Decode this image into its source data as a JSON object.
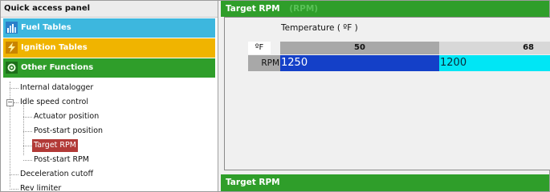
{
  "quick_access": {
    "title": "Quick access panel",
    "categories": [
      {
        "label": "Fuel Tables",
        "icon": "fuel-table-icon",
        "color": "#3db7de"
      },
      {
        "label": "Ignition Tables",
        "icon": "ignition-icon",
        "color": "#f0b400"
      },
      {
        "label": "Other Functions",
        "icon": "other-functions-icon",
        "color": "#2f9e2a"
      }
    ],
    "tree": [
      {
        "label": "Internal datalogger"
      },
      {
        "label": "Idle speed control",
        "expanded": true
      },
      {
        "label": "Actuator position"
      },
      {
        "label": "Post-start position"
      },
      {
        "label": "Target RPM",
        "selected": true
      },
      {
        "label": "Post-start RPM"
      },
      {
        "label": "Deceleration cutoff"
      },
      {
        "label": "Rev limiter"
      }
    ]
  },
  "table1": {
    "title": "Target RPM",
    "unit": "(RPM)",
    "axis_title": "Temperature  (  ºF  )",
    "corner_label": "ºF",
    "row_label": "RPM",
    "columns": [
      "50",
      "68"
    ],
    "values": [
      "1250",
      "1200"
    ],
    "colors": {
      "header_bg": "#2f9e2a",
      "col1_header": "#a8a8a8",
      "col2_header": "#d8d8d8",
      "cell1": "#1440c8",
      "cell2": "#00e6f5"
    }
  },
  "table2": {
    "title": "Target RPM"
  }
}
